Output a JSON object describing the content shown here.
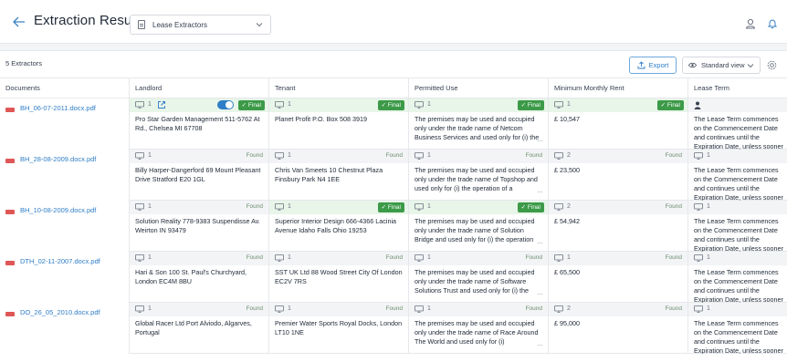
{
  "header": {
    "back_icon": "arrow-left-icon",
    "title": "Extraction Results",
    "extractor_select": "Lease Extractors",
    "user_icon": "user-icon",
    "bell_icon": "bell-icon"
  },
  "toolbar": {
    "count": "5 Extractors",
    "export_label": "Export",
    "view_label": "Standard view",
    "settings_icon": "gear-icon"
  },
  "columns": [
    "Documents",
    "Landlord",
    "Tenant",
    "Permitted Use",
    "Minimum Monthly Rent",
    "Lease Term"
  ],
  "rows": [
    {
      "document": "BH_06-07-2011.docx.pdf",
      "landlord": {
        "count": "1",
        "status": "Final",
        "text": "Pro Star Garden Management 511-5762 At Rd., Chelsea MI 67708"
      },
      "tenant": {
        "count": "1",
        "status": "Final",
        "text": "Planet Profit P.O. Box 508 3919"
      },
      "use": {
        "count": "1",
        "status": "Final",
        "text": "The premises may be used and occupied only under the trade name of Netcom Business Services and used only for (i) the"
      },
      "rent": {
        "count": "1",
        "status": "Final",
        "text": "£ 10,547"
      },
      "term": {
        "count": "",
        "status": "",
        "text": "The Lease Term commences on the Commencement Date and continues until the Expiration Date, unless sooner"
      }
    },
    {
      "document": "BH_28-08-2009.docx.pdf",
      "landlord": {
        "count": "1",
        "status": "Found",
        "text": "Billy Harper-Dangerford 69 Mount Pleasant Drive Stratford E20 1GL"
      },
      "tenant": {
        "count": "1",
        "status": "Found",
        "text": "Chris Van Smeets 10 Chestnut Plaza Finsbury Park N4 1EE"
      },
      "use": {
        "count": "1",
        "status": "Found",
        "text": "The premises may be used and occupied only under the trade name of Topshop and used only for (i) the operation of a"
      },
      "rent": {
        "count": "2",
        "status": "Found",
        "text": "£ 23,500"
      },
      "term": {
        "count": "1",
        "status": "",
        "text": "The Lease Term commences on the Commencement Date and continues until the Expiration Date, unless sooner"
      }
    },
    {
      "document": "BH_10-08-2009.docx.pdf",
      "landlord": {
        "count": "1",
        "status": "Found",
        "text": "Solution Reality 778-9383 Suspendisse Av. Weirton IN 93479"
      },
      "tenant": {
        "count": "1",
        "status": "Final",
        "text": "Superior Interior Design 666-4366 Lacinia Avenue Idaho Falls Ohio 19253"
      },
      "use": {
        "count": "1",
        "status": "Final",
        "text": "The premises may be used and occupied only under the trade name of Solution Bridge and used only for (i) the operation"
      },
      "rent": {
        "count": "2",
        "status": "Found",
        "text": "£ 54,942"
      },
      "term": {
        "count": "1",
        "status": "",
        "text": "The Lease Term commences on the Commencement Date and continues until the Expiration Date, unless sooner"
      }
    },
    {
      "document": "DTH_02-11-2007.docx.pdf",
      "landlord": {
        "count": "1",
        "status": "Found",
        "text": "Hari & Son 100 St. Paul's Churchyard, London EC4M 8BU"
      },
      "tenant": {
        "count": "1",
        "status": "Found",
        "text": "SST UK Ltd 88 Wood Street City Of London EC2V 7RS"
      },
      "use": {
        "count": "1",
        "status": "Found",
        "text": "The premises may be used and occupied only under the trade name of Software Solutions Trust and used only for (i) the"
      },
      "rent": {
        "count": "1",
        "status": "Found",
        "text": "£ 65,500"
      },
      "term": {
        "count": "1",
        "status": "",
        "text": "The Lease Term commences on the Commencement Date and continues until the Expiration Date, unless sooner"
      }
    },
    {
      "document": "DO_26_05_2010.docx.pdf",
      "landlord": {
        "count": "1",
        "status": "Found",
        "text": "Global Racer Ltd Port Alviodo, Algarves, Portugal"
      },
      "tenant": {
        "count": "1",
        "status": "Found",
        "text": "Premier Water Sports Royal Docks, London LT10 1NE"
      },
      "use": {
        "count": "1",
        "status": "Found",
        "text": "The premises may be used and occupied only under the trade name of Race Around The World and used only for (i)"
      },
      "rent": {
        "count": "2",
        "status": "Found",
        "text": "£ 95,000"
      },
      "term": {
        "count": "1",
        "status": "",
        "text": "The Lease Term commences on the Commencement Date and continues until the Expiration Date, unless sooner"
      }
    }
  ],
  "colors": {
    "accent": "#2f7ec7",
    "final": "#3c9a48",
    "final_bg": "#e8f5e9",
    "pdf": "#e05656"
  }
}
